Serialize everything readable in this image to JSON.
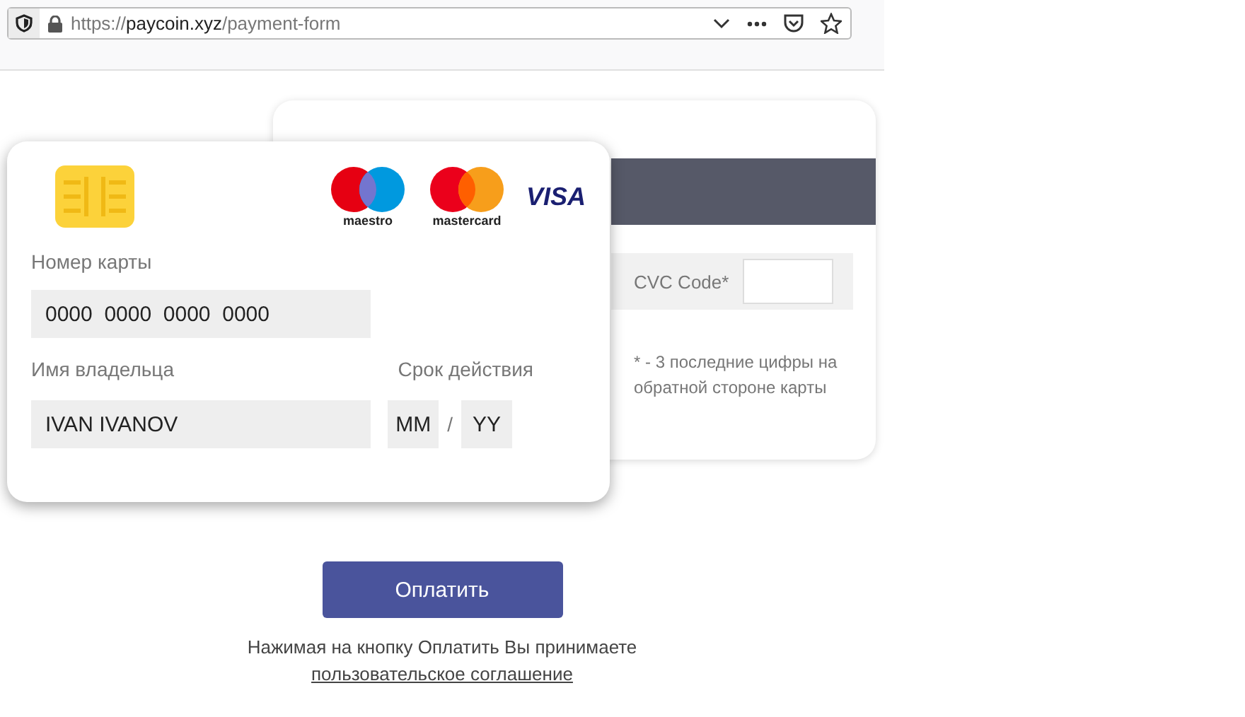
{
  "address_bar": {
    "url": "https://**paycoin.xyz**/payment-form"
  },
  "card_back": {
    "cvc_label": "CVC Code*",
    "note": "* - 3 последние цифры на обратной стороне карты"
  },
  "card_front": {
    "brands": [
      "maestro",
      "mastercard",
      "VISA"
    ],
    "number_label": "Номер карты",
    "number_placeholder": "0000  0000  0000  0000",
    "holder_label": "Имя владельца",
    "holder_placeholder": "IVAN IVANOV",
    "expiry_label": "Срок действия",
    "month_placeholder": "MM",
    "separator": "/",
    "year_placeholder": "YY"
  },
  "pay_button": "Оплатить",
  "agreement": {
    "text": "Нажимая на кнопку Оплатить Вы принимаете",
    "link": "пользовательское соглашение"
  }
}
